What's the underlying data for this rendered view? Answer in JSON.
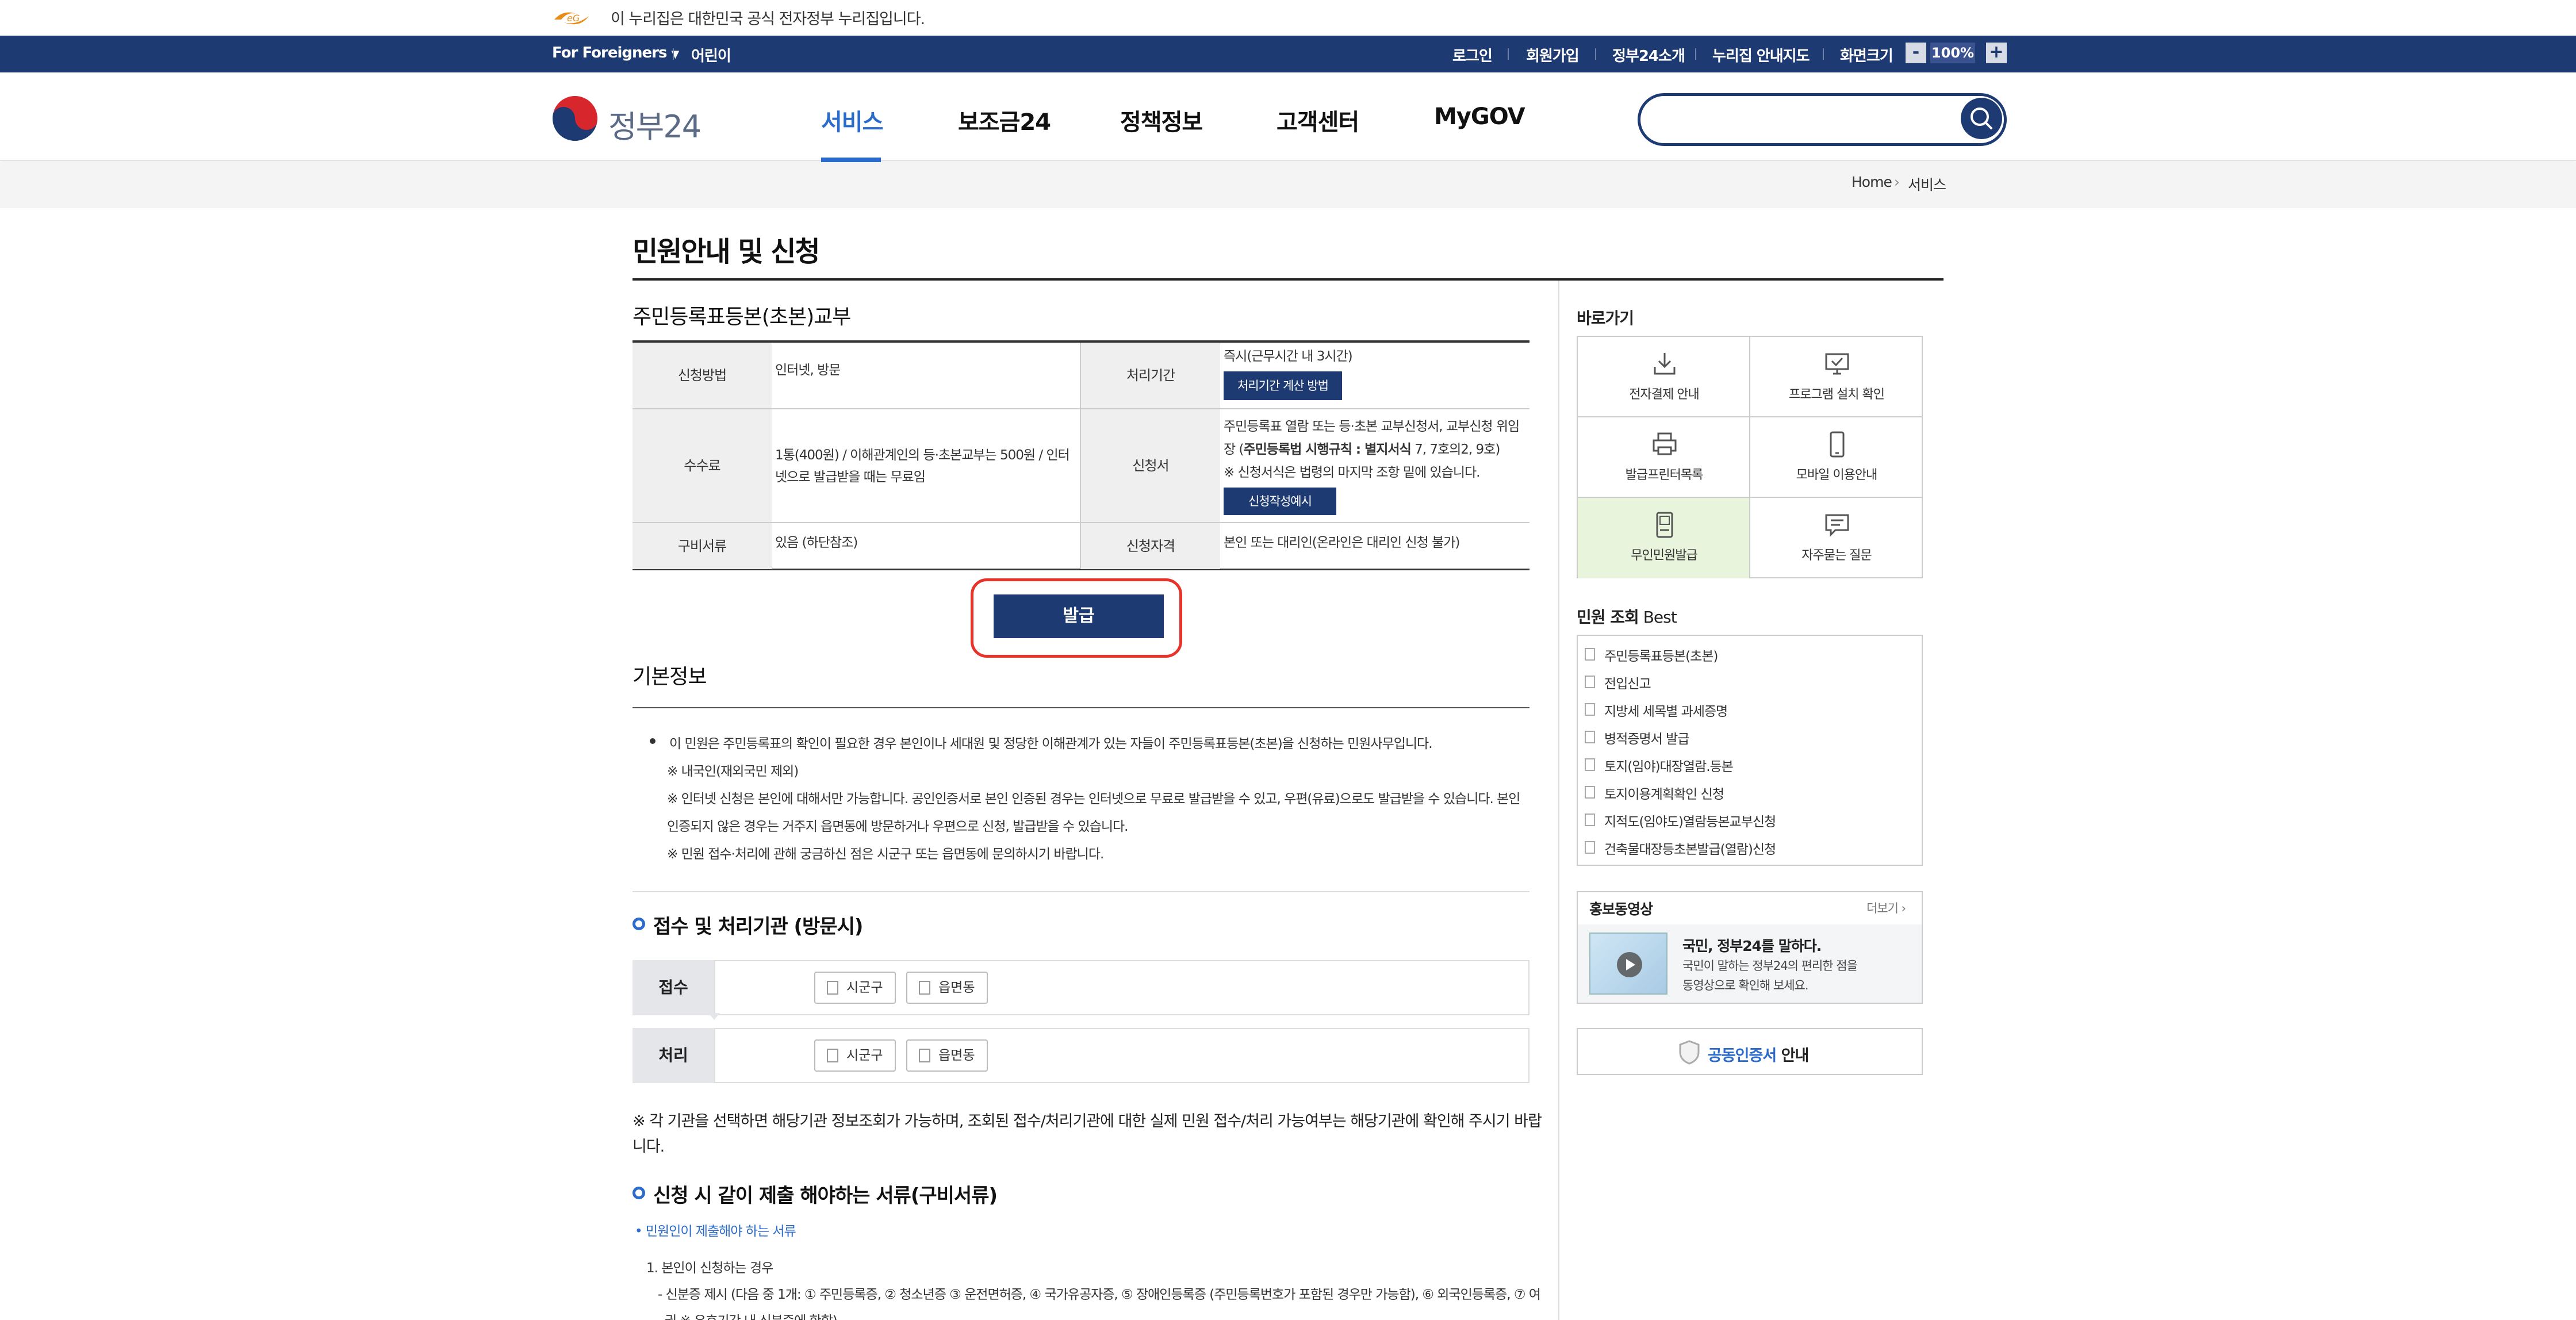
{
  "gov_banner": {
    "text": "이 누리집은 대한민국 공식 전자정부 누리집입니다."
  },
  "util": {
    "foreigners": "For Foreigners",
    "kids": "어린이",
    "login": "로그인",
    "join": "회원가입",
    "about": "정부24소개",
    "guide_map": "누리집 안내지도",
    "screen_size": "화면크기",
    "zoom_minus": "-",
    "zoom": "100%",
    "zoom_plus": "+"
  },
  "header": {
    "site_name": "정부24",
    "nav": [
      "서비스",
      "보조금24",
      "정책정보",
      "고객센터",
      "MyGOV"
    ],
    "search_placeholder": ""
  },
  "breadcrumb": {
    "home": "Home",
    "current": "서비스"
  },
  "page_title": "민원안내 및 신청",
  "service": {
    "title": "주민등록표등본(초본)교부",
    "rows": {
      "method_label": "신청방법",
      "method": "인터넷, 방문",
      "period_label": "처리기간",
      "period": "즉시(근무시간 내 3시간)",
      "period_btn": "처리기간 계산 방법",
      "fee_label": "수수료",
      "fee_line1": "1통(400원) / 이해관계인의 등·초본교부는 500원 / 인터",
      "fee_line2": "넷으로 발급받을 때는 무료임",
      "form_label": "신청서",
      "form_line1": "주민등록표 열람 또는 등·초본 교부신청서, 교부신청 위임",
      "form_line2_a": "장 (",
      "form_line2_b": "주민등록법 시행규칙 : 별지서식",
      "form_line2_c": " 7, 7호의2, 9호)",
      "form_line3": "※ 신청서식은 법령의 마지막 조항 밑에 있습니다.",
      "form_btn": "신청작성예시",
      "docs_label": "구비서류",
      "docs": "있음 (하단참조)",
      "qual_label": "신청자격",
      "qual": "본인 또는 대리인(온라인은 대리인 신청 불가)"
    },
    "issue_btn": "발급"
  },
  "basic": {
    "title": "기본정보",
    "p1": "이 민원은 주민등록표의 확인이 필요한 경우 본인이나 세대원 및 정당한 이해관계가 있는 자들이 주민등록표등본(초본)을 신청하는 민원사무입니다.",
    "p2": "※ 내국인(재외국민 제외)",
    "p3": "※ 인터넷 신청은 본인에 대해서만 가능합니다. 공인인증서로 본인 인증된 경우는 인터넷으로 무료로 발급받을 수 있고, 우편(유료)으로도 발급받을 수 있습니다. 본인",
    "p4": "인증되지 않은 경우는 거주지 읍면동에 방문하거나 우편으로 신청, 발급받을 수 있습니다.",
    "p5": "※ 민원 접수·처리에 관해 궁금하신 점은 시군구 또는 읍면동에 문의하시기 바랍니다."
  },
  "org": {
    "title": "접수 및 처리기관 (방문시)",
    "receive_label": "접수",
    "process_label": "처리",
    "chip1": "시군구",
    "chip2": "읍면동",
    "note_line1": "※ 각 기관을 선택하면 해당기관 정보조회가 가능하며, 조회된 접수/처리기관에 대한 실제 민원 접수/처리 가능여부는 해당기관에 확인해 주시기 바랍",
    "note_line2": "니다."
  },
  "docs": {
    "title": "신청 시 같이 제출 해야하는 서류(구비서류)",
    "sub": "• 민원인이 제출해야 하는 서류",
    "item1": "1. 본인이 신청하는 경우",
    "item1_detail": "- 신분증 제시 (다음 중 1개: ① 주민등록증, ② 청소년증 ③ 운전면허증, ④ 국가유공자증, ⑤ 장애인등록증 (주민등록번호가 포함된 경우만 가능함), ⑥ 외국인등록증, ⑦ 여",
    "item1_detail2": "권 ※ 유효기간 내 신분증에 한함)"
  },
  "sidebar": {
    "quick_title": "바로가기",
    "quick": [
      "전자결제 안내",
      "프로그램 설치 확인",
      "발급프린터목록",
      "모바일 이용안내",
      "무인민원발급",
      "자주묻는 질문"
    ],
    "best_title_a": "민원 조회",
    "best_title_b": " Best",
    "best": [
      "주민등록표등본(초본)",
      "전입신고",
      "지방세 세목별 과세증명",
      "병적증명서 발급",
      "토지(임야)대장열람.등본",
      "토지이용계획확인 신청",
      "지적도(임야도)열람등본교부신청",
      "건축물대장등초본발급(열람)신청"
    ],
    "promo_title": "홍보동영상",
    "promo_more": "더보기 ›",
    "promo_head": "국민, 정부24를 말하다.",
    "promo_line1": "국민이 말하는 정부24의 편리한 점을",
    "promo_line2": "동영상으로 확인해 보세요.",
    "cert_a": "공동인증서",
    "cert_b": " 안내"
  },
  "colors": {
    "navy": "#1d3a72",
    "accent_blue": "#2b6bcc",
    "highlight_red": "#e8332a",
    "quick_active_bg": "#e8f5dc"
  }
}
